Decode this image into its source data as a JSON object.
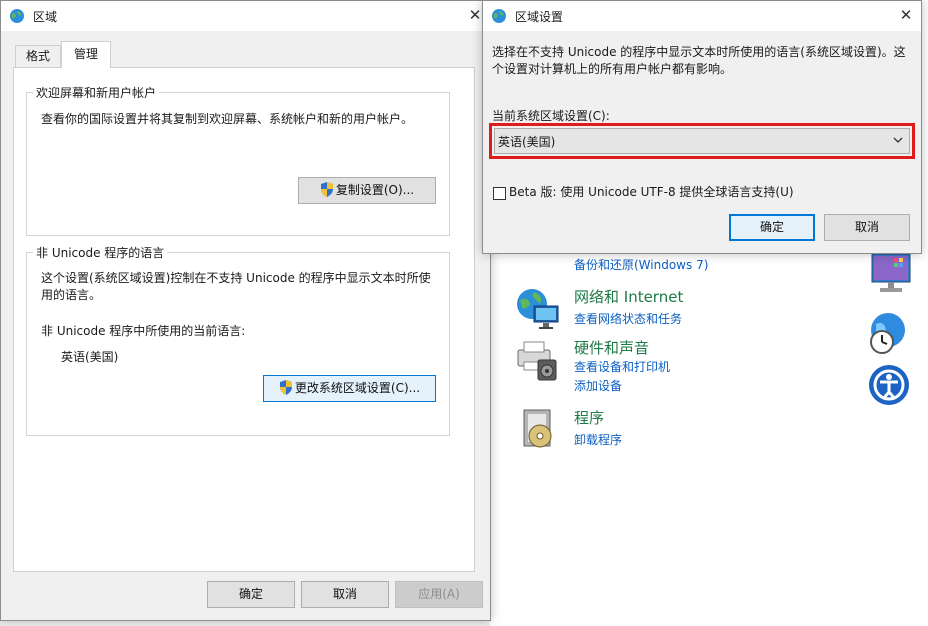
{
  "control_panel": {
    "backup_link": "备份和还原(Windows 7)",
    "categories": [
      {
        "title": "网络和 Internet",
        "links": [
          "查看网络状态和任务"
        ]
      },
      {
        "title": "硬件和声音",
        "links": [
          "查看设备和打印机",
          "添加设备"
        ]
      },
      {
        "title": "程序",
        "links": [
          "卸载程序"
        ]
      }
    ]
  },
  "region_window": {
    "title": "区域",
    "close_glyph": "✕",
    "tabs": [
      "格式",
      "管理"
    ],
    "welcome_group": {
      "legend": "欢迎屏幕和新用户帐户",
      "description": "查看你的国际设置并将其复制到欢迎屏幕、系统帐户和新的用户帐户。",
      "copy_button": "复制设置(O)..."
    },
    "unicode_group": {
      "legend": "非 Unicode 程序的语言",
      "description": "这个设置(系统区域设置)控制在不支持 Unicode 的程序中显示文本时所使用的语言。",
      "current_label": "非 Unicode 程序中所使用的当前语言:",
      "current_value": "英语(美国)",
      "change_button": "更改系统区域设置(C)..."
    },
    "ok": "确定",
    "cancel": "取消",
    "apply": "应用(A)"
  },
  "locale_dialog": {
    "title": "区域设置",
    "close_glyph": "✕",
    "description": "选择在不支持 Unicode 的程序中显示文本时所使用的语言(系统区域设置)。这个设置对计算机上的所有用户帐户都有影响。",
    "current_label": "当前系统区域设置(C):",
    "selected_locale": "英语(美国)",
    "beta_checkbox": "Beta 版: 使用 Unicode UTF-8 提供全球语言支持(U)",
    "beta_checked": false,
    "ok": "确定",
    "cancel": "取消",
    "highlight_color": "#e01b1b"
  }
}
